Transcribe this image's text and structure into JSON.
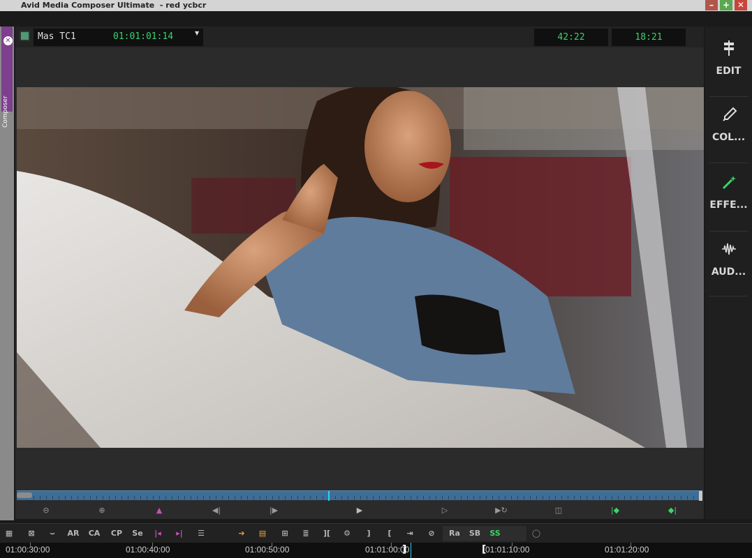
{
  "window": {
    "title": "Avid Media Composer Ultimate  - red ycbcr",
    "controls": [
      "minimize",
      "maximize",
      "close"
    ]
  },
  "sidebar_tab": {
    "label": "Composer",
    "close_glyph": "✕"
  },
  "monitor": {
    "timecode_label": "Mas  TC1",
    "timecode_value": "01:01:01:14",
    "dropdown_glyph": "▼",
    "duration_1": "42:22",
    "duration_2": "18:21",
    "image_description": "Woman in denim jacket seated in white convertible car at sunset"
  },
  "right_panel": {
    "items": [
      {
        "label": "EDIT",
        "icon": "edit-workspace-icon"
      },
      {
        "label": "COL...",
        "icon": "color-eyedropper-icon"
      },
      {
        "label": "EFFE...",
        "icon": "effects-wand-icon"
      },
      {
        "label": "AUD...",
        "icon": "audio-waveform-icon"
      }
    ]
  },
  "toolbar": {
    "buttons": [
      {
        "label": "AR"
      },
      {
        "label": "CA"
      },
      {
        "label": "CP"
      },
      {
        "label": "Se"
      },
      {
        "label": "Ra"
      },
      {
        "label": "SB"
      },
      {
        "label": "SS"
      }
    ]
  },
  "ruler": {
    "labels": [
      "01:00:30:00",
      "01:00:40:00",
      "01:00:50:00",
      "01:01:00:00",
      "01:01:10:00",
      "01:01:20:00"
    ]
  },
  "colors": {
    "accent_green": "#38d36c",
    "accent_purple": "#7e3f8e",
    "scrub_blue": "#3e6d96",
    "position_cyan": "#2bd0ff"
  }
}
